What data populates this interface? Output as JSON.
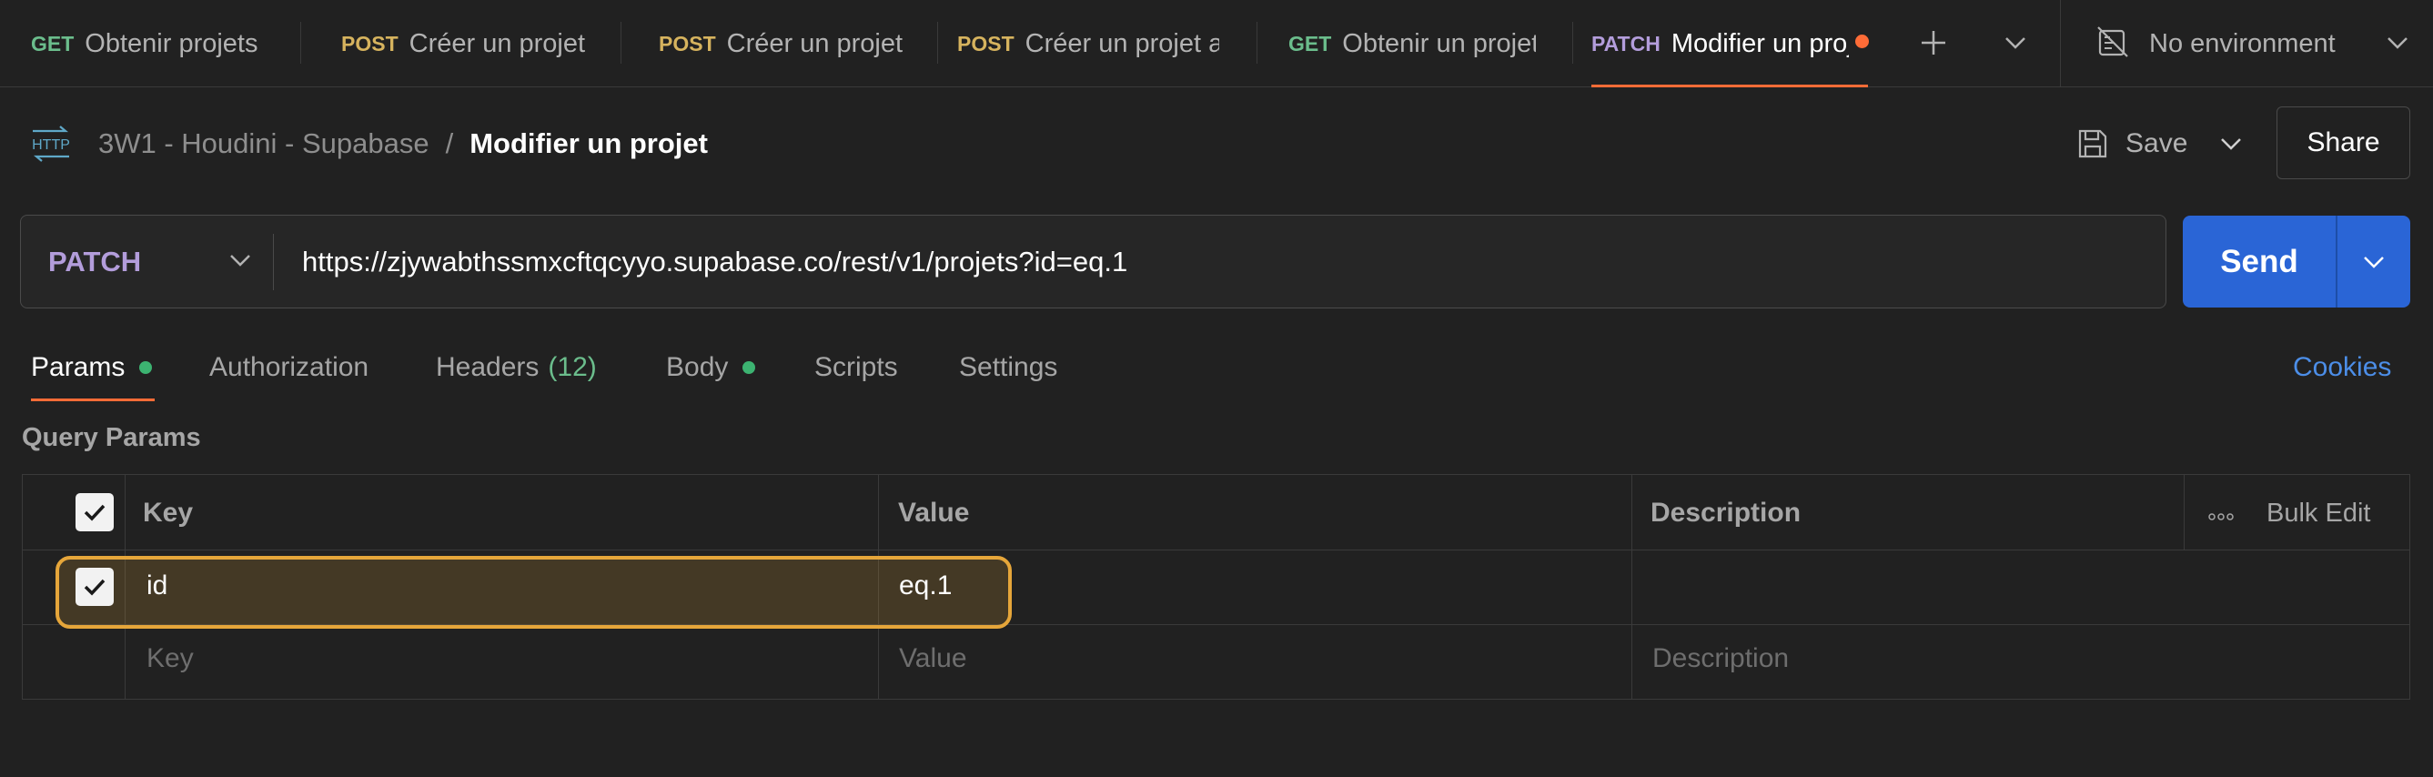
{
  "tabs": [
    {
      "method": "GET",
      "title": "Obtenir projets"
    },
    {
      "method": "POST",
      "title": "Créer un projet"
    },
    {
      "method": "POST",
      "title": "Créer un projet"
    },
    {
      "method": "POST",
      "title": "Créer un projet a"
    },
    {
      "method": "GET",
      "title": "Obtenir un projet"
    },
    {
      "method": "PATCH",
      "title": "Modifier un proj",
      "active": true,
      "unsaved": true
    }
  ],
  "environment": "No environment",
  "breadcrumb": {
    "protocol_icon": "HTTP",
    "collection": "3W1 - Houdini - Supabase",
    "separator": "/",
    "request": "Modifier un projet"
  },
  "actions": {
    "save": "Save",
    "share": "Share"
  },
  "request": {
    "method": "PATCH",
    "url": "https://zjywabthssmxcftqcyyo.supabase.co/rest/v1/projets?id=eq.1",
    "send": "Send"
  },
  "request_tabs": [
    {
      "label": "Params",
      "active": true,
      "dot": true
    },
    {
      "label": "Authorization"
    },
    {
      "label": "Headers",
      "count": "(12)"
    },
    {
      "label": "Body",
      "dot": true
    },
    {
      "label": "Scripts"
    },
    {
      "label": "Settings"
    }
  ],
  "cookies": "Cookies",
  "query_params": {
    "title": "Query Params",
    "headers": {
      "key": "Key",
      "value": "Value",
      "description": "Description",
      "bulk_edit": "Bulk Edit"
    },
    "rows": [
      {
        "key": "id",
        "value": "eq.1",
        "checked": true
      }
    ],
    "placeholders": {
      "key": "Key",
      "value": "Value",
      "description": "Description"
    }
  },
  "colors": {
    "accent": "#ff6c37",
    "send": "#2a65d6",
    "patch": "#b39ddb",
    "get": "#6bbd8c",
    "post": "#d6b35e",
    "highlight": "#e6a63a"
  }
}
